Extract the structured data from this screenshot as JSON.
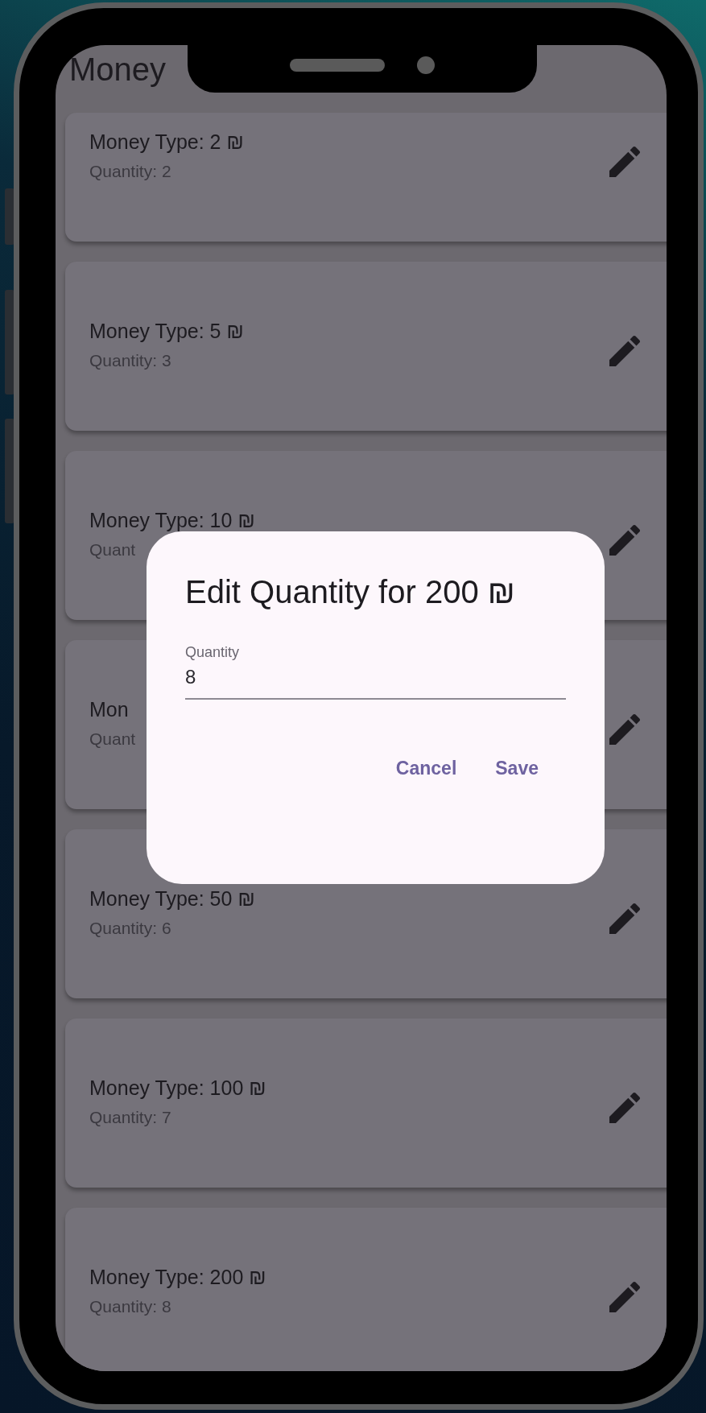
{
  "app_bar": {
    "title": "Money"
  },
  "items": [
    {
      "title": "Money Type: 2 ₪",
      "quantity": "Quantity: 2"
    },
    {
      "title": "Money Type: 5 ₪",
      "quantity": "Quantity: 3"
    },
    {
      "title": "Money Type: 10 ₪",
      "quantity": "Quant"
    },
    {
      "title": "Mon",
      "quantity": "Quant"
    },
    {
      "title": "Money Type: 50 ₪",
      "quantity": "Quantity: 6"
    },
    {
      "title": "Money Type: 100 ₪",
      "quantity": "Quantity: 7"
    },
    {
      "title": "Money Type: 200 ₪",
      "quantity": "Quantity: 8"
    }
  ],
  "dialog": {
    "title": "Edit Quantity for 200 ₪",
    "field": {
      "label": "Quantity",
      "value": "8"
    },
    "buttons": [
      "Cancel",
      "Save"
    ]
  }
}
